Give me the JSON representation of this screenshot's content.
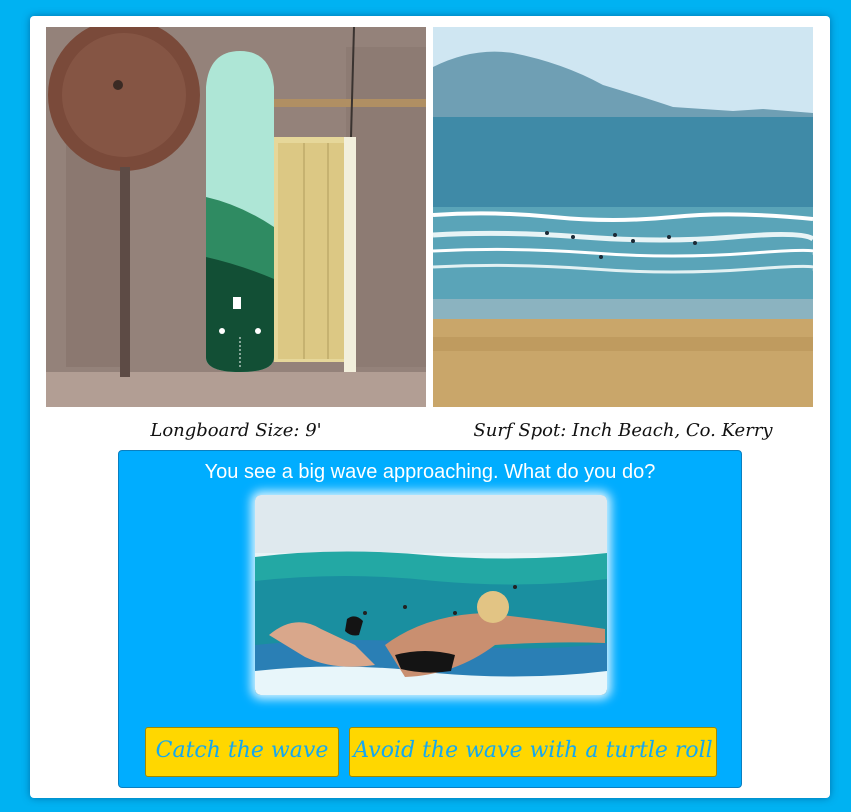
{
  "captions": {
    "board": "Longboard Size: 9'",
    "beach": "Surf Spot: Inch Beach, Co. Kerry"
  },
  "question": {
    "prompt": "You see a big wave approaching. What do you do?"
  },
  "choices": [
    {
      "label": "Catch the wave"
    },
    {
      "label": "Avoid the wave with a turtle roll"
    }
  ],
  "colors": {
    "background": "#00b2f2",
    "panel": "#00adff",
    "button": "#ffd700",
    "button_text": "#14a8f0"
  }
}
